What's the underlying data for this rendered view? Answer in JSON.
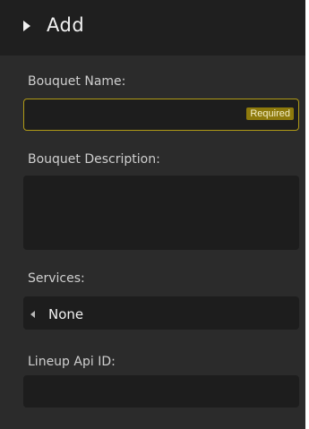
{
  "header": {
    "title": "Add",
    "expand_icon": "triangle-right-icon"
  },
  "form": {
    "bouquet_name": {
      "label": "Bouquet Name:",
      "value": "",
      "badge": "Required"
    },
    "bouquet_description": {
      "label": "Bouquet Description:",
      "value": ""
    },
    "services": {
      "label": "Services:",
      "selected": "None",
      "arrow_icon": "triangle-left-icon"
    },
    "lineup_api_id": {
      "label": "Lineup Api ID:",
      "value": ""
    }
  },
  "colors": {
    "panel_bg": "#2b2b2b",
    "header_bg": "#1f1f1f",
    "field_bg": "#1d1d1d",
    "required_border": "#b09a17",
    "required_badge": "#8e7a0c"
  }
}
